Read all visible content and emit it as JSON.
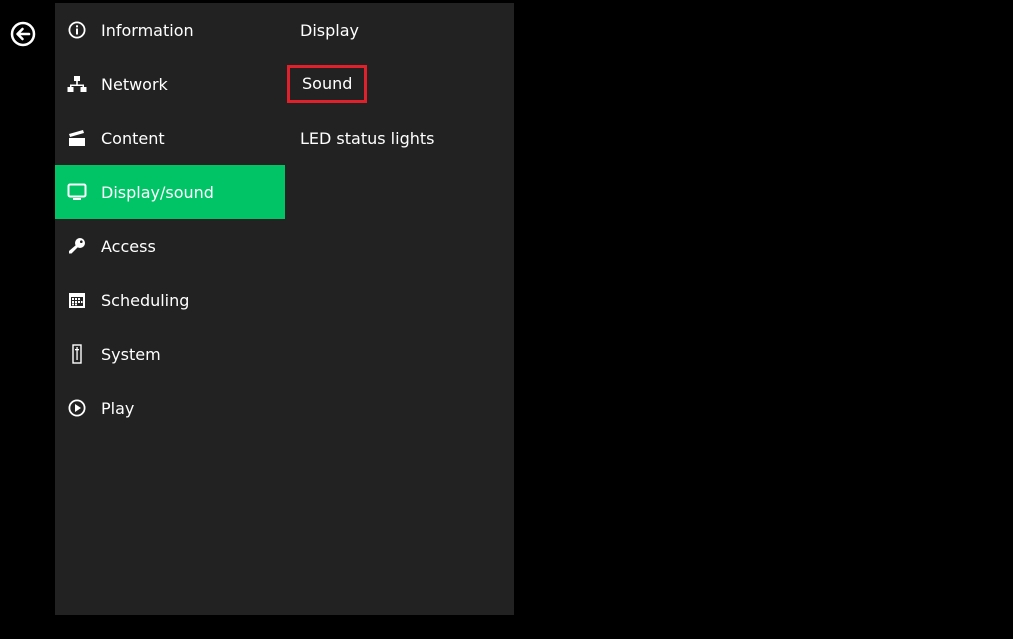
{
  "back": {
    "icon": "back-arrow-icon"
  },
  "main_menu": [
    {
      "label": "Information",
      "icon": "info-icon",
      "active": false
    },
    {
      "label": "Network",
      "icon": "network-icon",
      "active": false
    },
    {
      "label": "Content",
      "icon": "clapperboard-icon",
      "active": false
    },
    {
      "label": "Display/sound",
      "icon": "monitor-icon",
      "active": true
    },
    {
      "label": "Access",
      "icon": "key-icon",
      "active": false
    },
    {
      "label": "Scheduling",
      "icon": "calendar-icon",
      "active": false
    },
    {
      "label": "System",
      "icon": "system-icon",
      "active": false
    },
    {
      "label": "Play",
      "icon": "play-icon",
      "active": false
    }
  ],
  "sub_menu": [
    {
      "label": "Display",
      "highlighted": false
    },
    {
      "label": "Sound",
      "highlighted": true
    },
    {
      "label": "LED status lights",
      "highlighted": false
    }
  ],
  "colors": {
    "background": "#000000",
    "panel": "#222222",
    "active": "#00c466",
    "highlight_border": "#e0202a",
    "text": "#ffffff"
  }
}
